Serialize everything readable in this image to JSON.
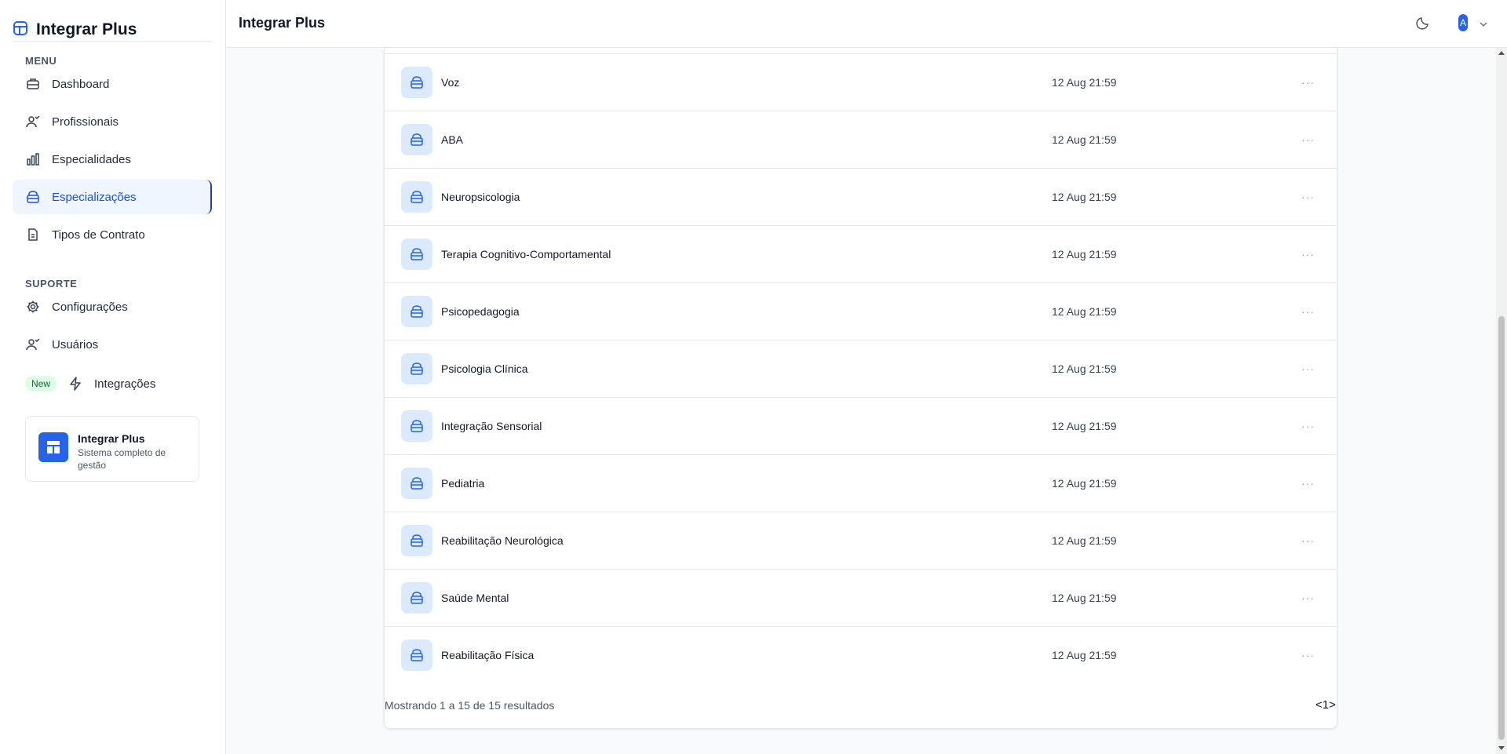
{
  "app": {
    "title": "Integrar Plus"
  },
  "header": {
    "title": "Integrar Plus",
    "avatar_initial": "A"
  },
  "sidebar": {
    "menu_label": "MENU",
    "menu_items": [
      {
        "label": "Dashboard",
        "icon": "briefcase-icon"
      },
      {
        "label": "Profissionais",
        "icon": "user-check-icon"
      },
      {
        "label": "Especialidades",
        "icon": "bar-chart-icon"
      },
      {
        "label": "Especializações",
        "icon": "briefcase-medical-icon",
        "active": true
      },
      {
        "label": "Tipos de Contrato",
        "icon": "document-icon"
      }
    ],
    "support_label": "SUPORTE",
    "support_items": [
      {
        "label": "Configurações",
        "icon": "gear-icon"
      },
      {
        "label": "Usuários",
        "icon": "user-check-icon"
      },
      {
        "label": "Integrações",
        "icon": "zap-icon",
        "badge": "New"
      }
    ],
    "promo": {
      "title": "Integrar Plus",
      "subtitle": "Sistema completo de gestão"
    }
  },
  "table": {
    "rows": [
      {
        "name": "Voz",
        "date": "12 Aug 21:59"
      },
      {
        "name": "ABA",
        "date": "12 Aug 21:59"
      },
      {
        "name": "Neuropsicologia",
        "date": "12 Aug 21:59"
      },
      {
        "name": "Terapia Cognitivo-Comportamental",
        "date": "12 Aug 21:59"
      },
      {
        "name": "Psicopedagogia",
        "date": "12 Aug 21:59"
      },
      {
        "name": "Psicologia Clínica",
        "date": "12 Aug 21:59"
      },
      {
        "name": "Integração Sensorial",
        "date": "12 Aug 21:59"
      },
      {
        "name": "Pediatria",
        "date": "12 Aug 21:59"
      },
      {
        "name": "Reabilitação Neurológica",
        "date": "12 Aug 21:59"
      },
      {
        "name": "Saúde Mental",
        "date": "12 Aug 21:59"
      },
      {
        "name": "Reabilitação Física",
        "date": "12 Aug 21:59"
      }
    ],
    "more_label": "···",
    "footer": "Mostrando 1 a 15 de 15 resultados",
    "pager": {
      "prev": "<",
      "current": "1",
      "next": ">"
    }
  },
  "colors": {
    "accent": "#2563eb",
    "active_bg": "#eff6ff",
    "badge_bg": "#dcfce7"
  }
}
